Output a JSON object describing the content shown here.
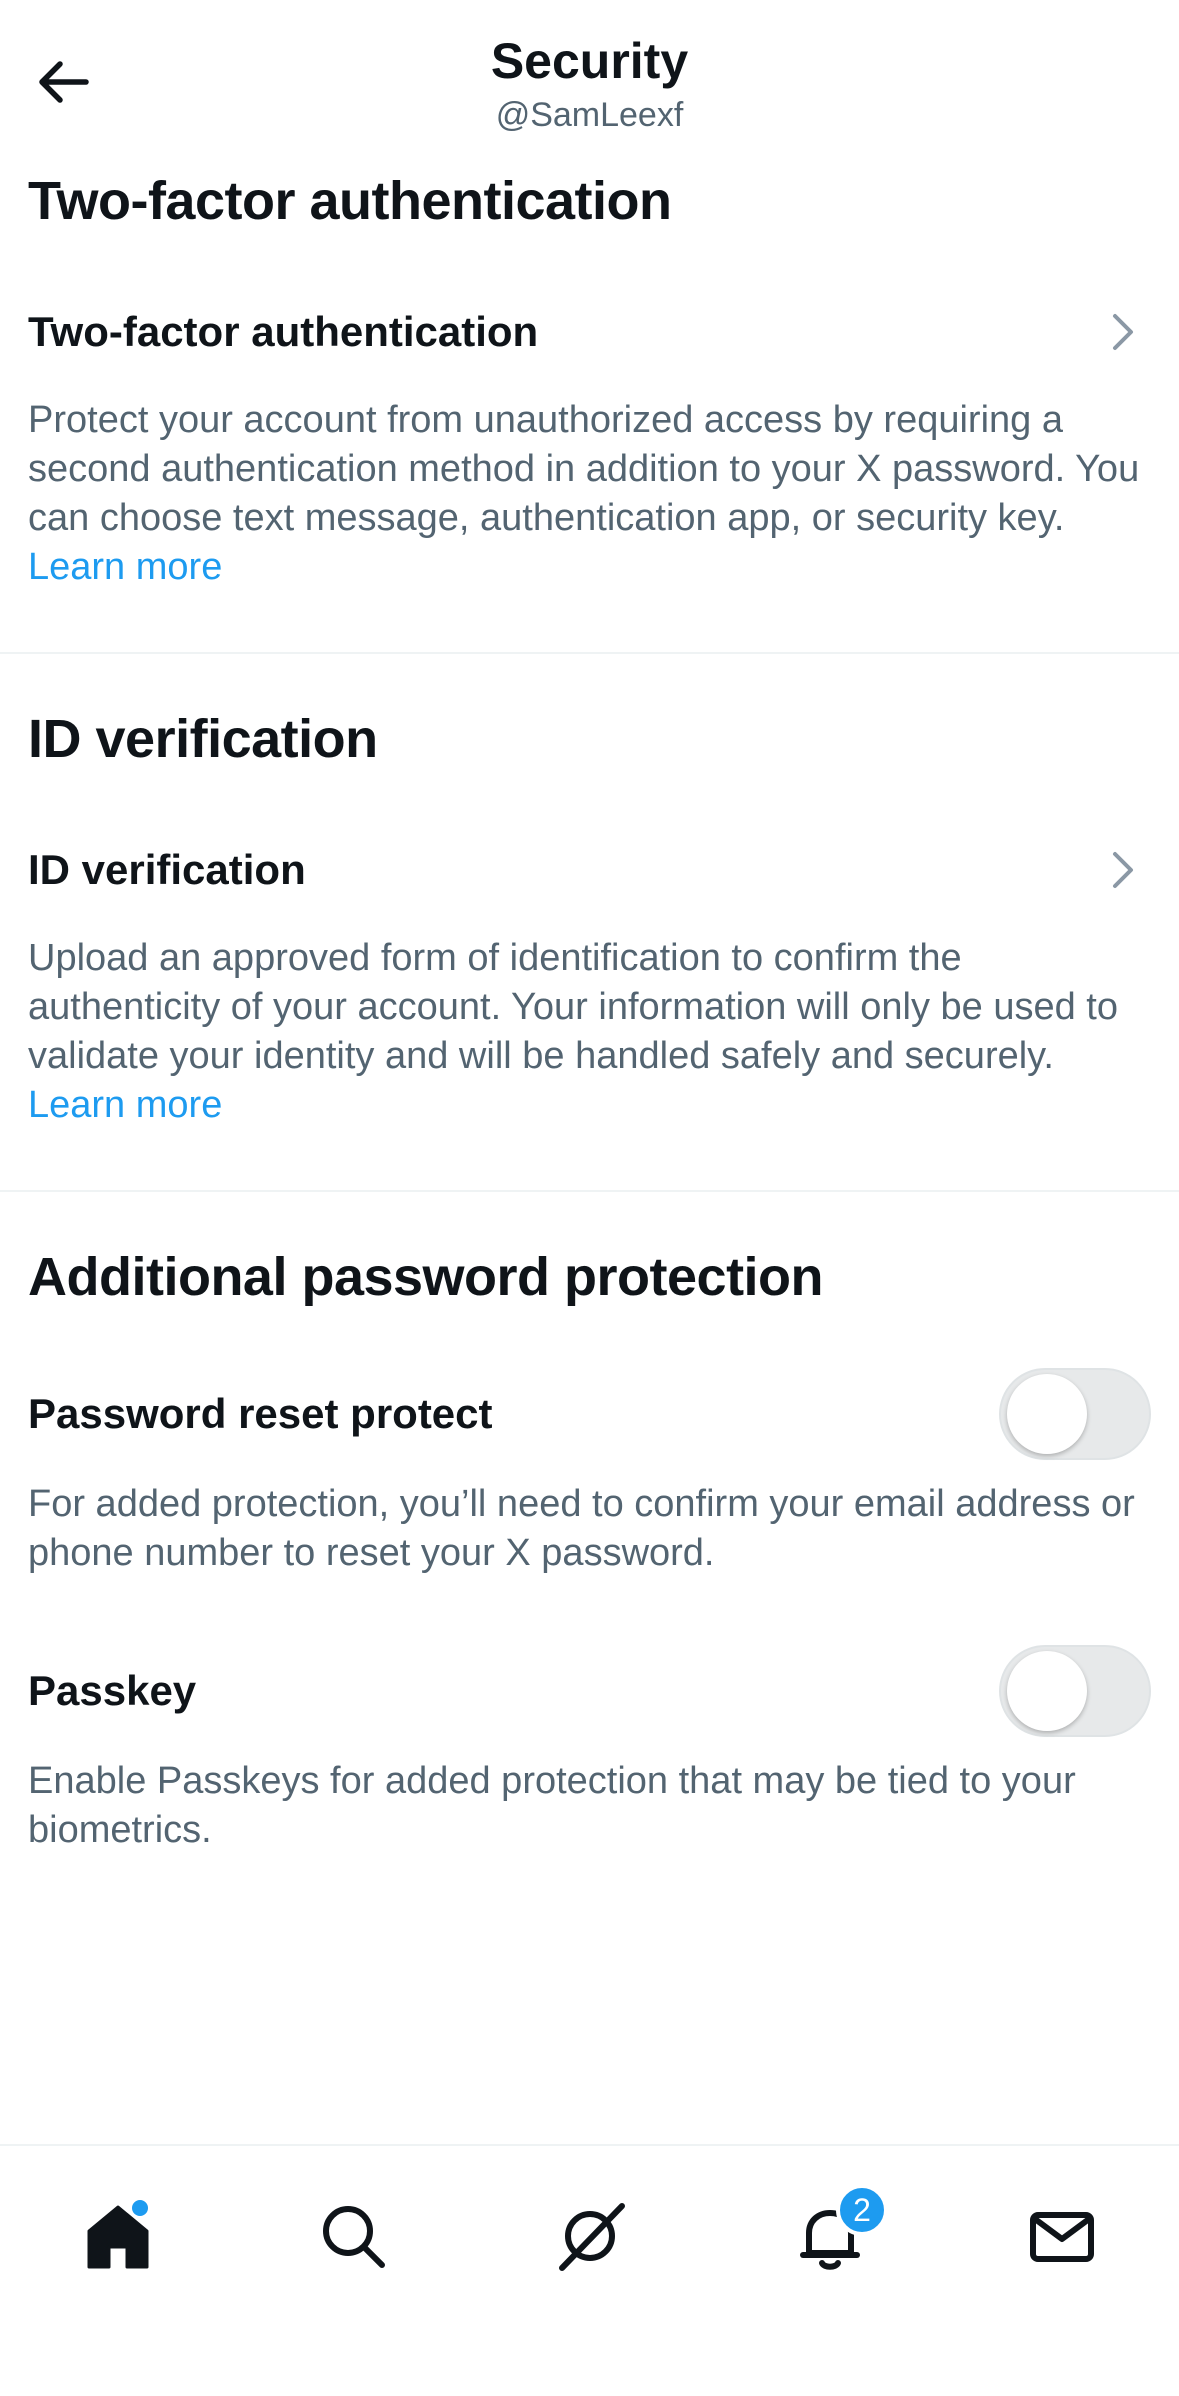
{
  "header": {
    "title": "Security",
    "username": "@SamLeexf"
  },
  "sections": {
    "two_factor": {
      "heading": "Two-factor authentication",
      "row_label": "Two-factor authentication",
      "description": "Protect your account from unauthorized access by requiring a second authentication method in addition to your X password. You can choose text message, authentication app, or security key.",
      "link": "Learn more"
    },
    "id_verification": {
      "heading": "ID verification",
      "row_label": "ID verification",
      "description": "Upload an approved form of identification to confirm the authenticity of your account. Your information will only be used to validate your identity and will be handled safely and securely.",
      "link": "Learn more"
    },
    "password_protection": {
      "heading": "Additional password protection",
      "reset_protect": {
        "label": "Password reset protect",
        "description": "For added protection, you’ll need to confirm your email address or phone number to reset your X password.",
        "enabled": false
      },
      "passkey": {
        "label": "Passkey",
        "description": "Enable Passkeys for added protection that may be tied to your biometrics.",
        "enabled": false
      }
    }
  },
  "bottom_nav": {
    "items": [
      {
        "name": "home-icon",
        "active": true
      },
      {
        "name": "search-icon"
      },
      {
        "name": "grok-icon"
      },
      {
        "name": "notifications-icon"
      },
      {
        "name": "messages-icon"
      }
    ],
    "notifications_badge": "2"
  },
  "colors": {
    "accent": "#1d9bf0",
    "text_primary": "#0f1419",
    "text_secondary": "#536471",
    "divider": "#eff3f4",
    "toggle_off": "#e7e9ea"
  }
}
